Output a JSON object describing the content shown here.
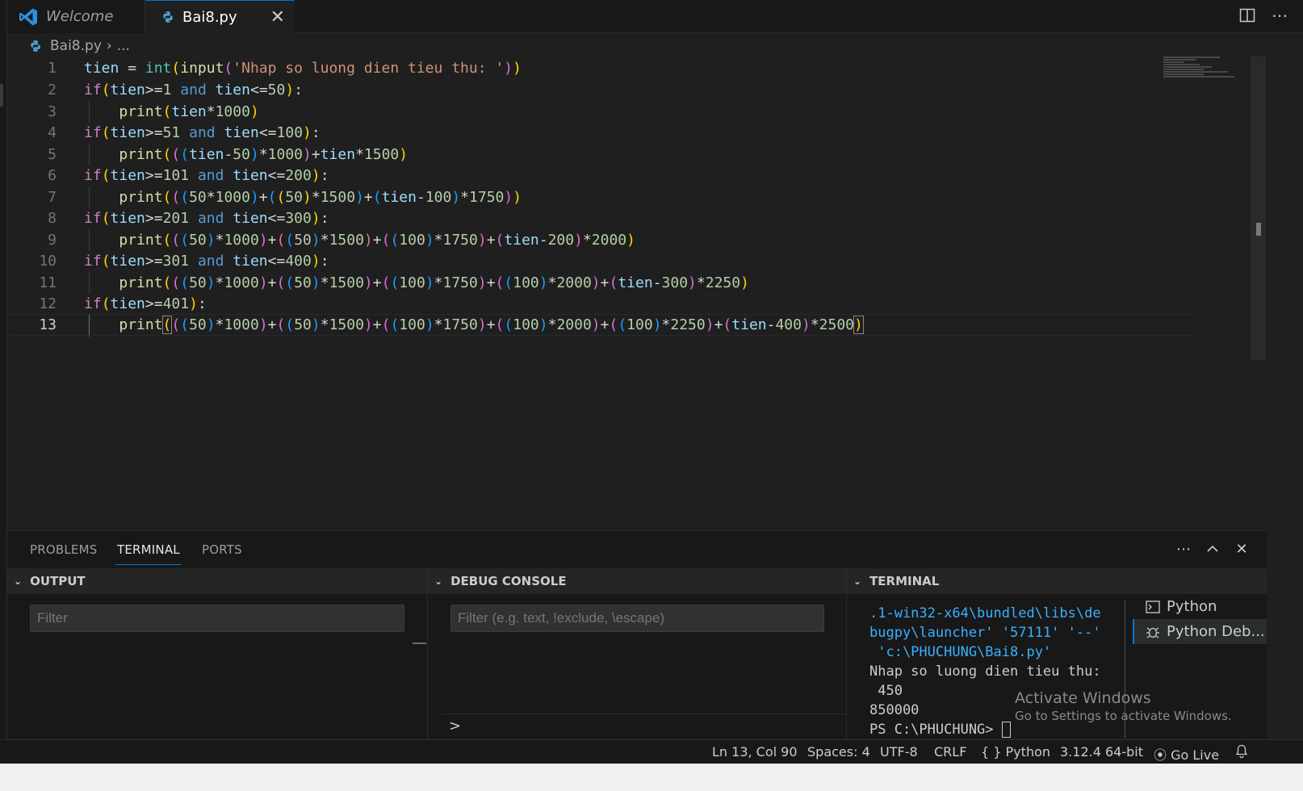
{
  "tabs": [
    {
      "label": "Welcome",
      "active": false
    },
    {
      "label": "Bai8.py",
      "active": true
    }
  ],
  "breadcrumb": {
    "file": "Bai8.py",
    "more": "..."
  },
  "editor": {
    "line_numbers": [
      "1",
      "2",
      "3",
      "4",
      "5",
      "6",
      "7",
      "8",
      "9",
      "10",
      "11",
      "12",
      "13"
    ],
    "current_line": "13",
    "code_lines": [
      "tien = int(input('Nhap so luong dien tieu thu: '))",
      "if(tien>=1 and tien<=50):",
      "    print(tien*1000)",
      "if(tien>=51 and tien<=100):",
      "    print(((tien-50)*1000)+tien*1500)",
      "if(tien>=101 and tien<=200):",
      "    print(((50*1000)+((50)*1500)+(tien-100)*1750))",
      "if(tien>=201 and tien<=300):",
      "    print(((50)*1000)+((50)*1500)+((100)*1750)+(tien-200)*2000)",
      "if(tien>=301 and tien<=400):",
      "    print(((50)*1000)+((50)*1500)+((100)*1750)+((100)*2000)+(tien-300)*2250)",
      "if(tien>=401):",
      "    print(((50)*1000)+((50)*1500)+((100)*1750)+((100)*2000)+((100)*2250)+(tien-400)*2500)"
    ]
  },
  "panel": {
    "tabs": [
      "PROBLEMS",
      "TERMINAL",
      "PORTS"
    ],
    "active_tab": "TERMINAL",
    "output": {
      "title": "OUTPUT",
      "filter_placeholder": "Filter"
    },
    "debug_console": {
      "title": "DEBUG CONSOLE",
      "filter_placeholder": "Filter (e.g. text, !exclude, \\escape)",
      "prompt": ">"
    },
    "terminal": {
      "title": "TERMINAL",
      "lines": [
        ".1-win32-x64\\bundled\\libs\\de",
        "bugpy\\launcher' '57111' '--'",
        " 'c:\\PHUCHUNG\\Bai8.py'",
        "Nhap so luong dien tieu thu:",
        " 450",
        "850000",
        "PS C:\\PHUCHUNG> "
      ],
      "sessions": [
        {
          "label": "Python",
          "icon": "terminal-icon"
        },
        {
          "label": "Python Deb...",
          "icon": "debug-icon"
        }
      ]
    }
  },
  "watermark": {
    "title": "Activate Windows",
    "subtitle": "Go to Settings to activate Windows."
  },
  "status_bar": {
    "position": "Ln 13, Col 90",
    "spaces": "Spaces: 4",
    "encoding": "UTF-8",
    "eol": "CRLF",
    "language": "Python",
    "language_icon": "{ }",
    "interpreter": "3.12.4 64-bit",
    "go_live": "Go Live"
  },
  "colors": {
    "accent": "#0078d4",
    "keyword": "#569cd6",
    "variable": "#9cdcfe",
    "number": "#b5cea8",
    "string": "#ce9178",
    "function": "#dcdcaa",
    "builtin": "#4ec9b0"
  }
}
